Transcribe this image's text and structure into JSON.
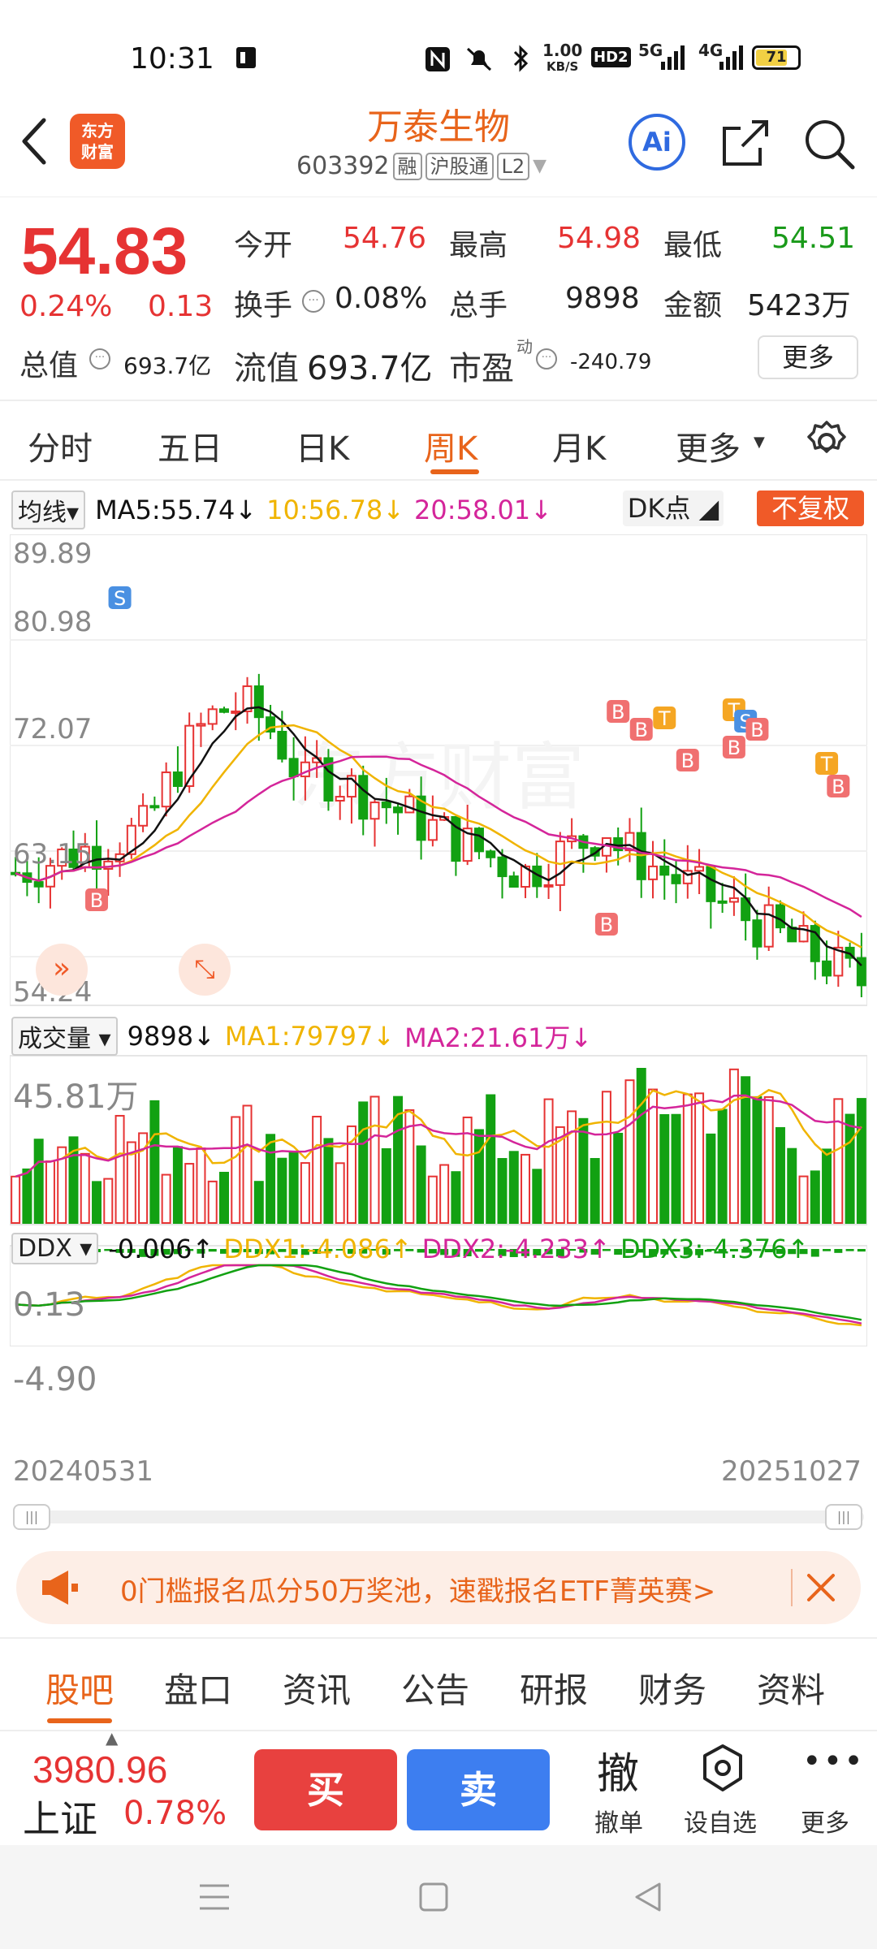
{
  "status": {
    "time": "10:31",
    "battery": "71",
    "net_speed_top": "1.00",
    "net_speed_unit": "KB/S",
    "signal_a": "5G",
    "signal_b": "4G",
    "hd": "HD2"
  },
  "header": {
    "logo_line1": "东方",
    "logo_line2": "财富",
    "title": "万泰生物",
    "code": "603392",
    "tag_margin": "融",
    "tag_connect": "沪股通",
    "tag_level": "L2",
    "ai_label": "Ai"
  },
  "quote": {
    "price": "54.83",
    "change_pct": "0.24%",
    "change_amt": "0.13",
    "open_label": "今开",
    "open": "54.76",
    "high_label": "最高",
    "high": "54.98",
    "low_label": "最低",
    "low": "54.51",
    "turnover_label": "换手",
    "turnover": "0.08%",
    "volume_label": "总手",
    "volume": "9898",
    "amount_label": "金额",
    "amount": "5423万",
    "mktcap_label": "总值",
    "mktcap": "693.7亿",
    "float_label": "流值",
    "float_cap": "693.7亿",
    "pe_label": "市盈",
    "pe_sup": "动",
    "pe": "-240.79",
    "more": "更多"
  },
  "period_tabs": [
    "分时",
    "五日",
    "日K",
    "周K",
    "月K",
    "更多"
  ],
  "period_active": "周K",
  "chart": {
    "ma_selector": "均线",
    "ma5": "MA5:55.74",
    "ma10": "10:56.78",
    "ma20": "20:58.01",
    "dk_label": "DK点",
    "fq_label": "不复权",
    "price_axis": [
      "89.89",
      "80.98",
      "72.07",
      "63.15",
      "54.24"
    ],
    "vol_selector": "成交量",
    "vol_value": "9898",
    "vol_ma1": "MA1:79797",
    "vol_ma2": "MA2:21.61万",
    "vol_axis_top": "45.81万",
    "ddx_selector": "DDX",
    "ddx_value": "-0.006",
    "ddx1": "DDX1:-4.086",
    "ddx2": "DDX2:-4.233",
    "ddx3": "DDX3:-4.376",
    "ddx_axis_top": "0.13",
    "ddx_axis_bottom": "-4.90",
    "date_start": "20240531",
    "date_end": "20251027",
    "watermark": "东方财富",
    "colors": {
      "up": "#e63333",
      "down": "#12a112",
      "ma5": "#111111",
      "ma10": "#f0b400",
      "ma20": "#d4259a"
    }
  },
  "banner": {
    "text": "0门槛报名瓜分50万奖池，速戳报名ETF菁英赛>"
  },
  "bottom_tabs": [
    "股吧",
    "盘口",
    "资讯",
    "公告",
    "研报",
    "财务",
    "资料"
  ],
  "bottom_active": "股吧",
  "trade": {
    "index_value": "3980.96",
    "index_name": "上证",
    "index_pct": "0.78%",
    "buy": "买",
    "sell": "卖",
    "cancel_big": "撤",
    "cancel": "撤单",
    "watchlist": "设自选",
    "more": "更多"
  }
}
